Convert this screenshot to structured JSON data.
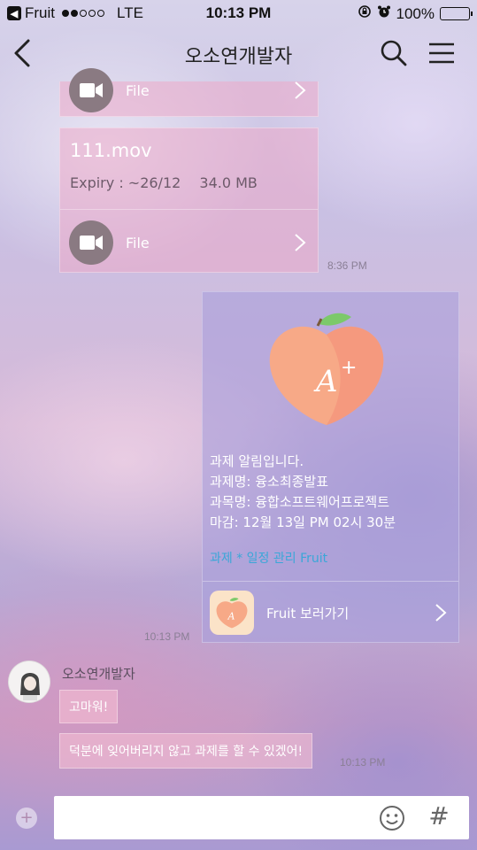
{
  "status_bar": {
    "back_app": "Fruit",
    "carrier": "LTE",
    "time": "10:13 PM",
    "battery": "100%"
  },
  "nav": {
    "title": "오소연개발자"
  },
  "messages": {
    "file1": {
      "label": "File"
    },
    "file2": {
      "name": "111.mov",
      "expiry": "Expiry : ~26/12",
      "size": "34.0 MB",
      "label": "File",
      "time": "8:36 PM"
    },
    "card": {
      "line1": "과제 알림입니다.",
      "line2": "과제명: 융소최종발표",
      "line3": "과목명: 융합소프트웨어프로젝트",
      "line4": "마감: 12월 13일 PM 02시 30분",
      "link": "과제 * 일정 관리 Fruit",
      "footer_label": "Fruit 보러가기",
      "time": "10:13 PM"
    },
    "incoming": {
      "sender": "오소연개발자",
      "msg1": "고마워!",
      "msg2": "덕분에 잊어버리지 않고 과제를 할 수 있겠어!",
      "time": "10:13 PM"
    }
  },
  "input": {
    "placeholder": "",
    "hash": "#"
  },
  "colors": {
    "link": "#3aa7d8",
    "peach": "#f7a987"
  }
}
